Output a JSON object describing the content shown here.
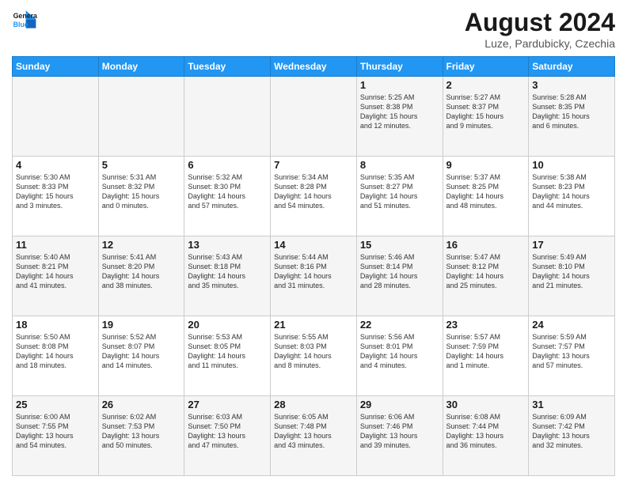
{
  "header": {
    "logo_line1": "General",
    "logo_line2": "Blue",
    "main_title": "August 2024",
    "subtitle": "Luze, Pardubicky, Czechia"
  },
  "weekdays": [
    "Sunday",
    "Monday",
    "Tuesday",
    "Wednesday",
    "Thursday",
    "Friday",
    "Saturday"
  ],
  "weeks": [
    [
      {
        "day": "",
        "info": ""
      },
      {
        "day": "",
        "info": ""
      },
      {
        "day": "",
        "info": ""
      },
      {
        "day": "",
        "info": ""
      },
      {
        "day": "1",
        "info": "Sunrise: 5:25 AM\nSunset: 8:38 PM\nDaylight: 15 hours\nand 12 minutes."
      },
      {
        "day": "2",
        "info": "Sunrise: 5:27 AM\nSunset: 8:37 PM\nDaylight: 15 hours\nand 9 minutes."
      },
      {
        "day": "3",
        "info": "Sunrise: 5:28 AM\nSunset: 8:35 PM\nDaylight: 15 hours\nand 6 minutes."
      }
    ],
    [
      {
        "day": "4",
        "info": "Sunrise: 5:30 AM\nSunset: 8:33 PM\nDaylight: 15 hours\nand 3 minutes."
      },
      {
        "day": "5",
        "info": "Sunrise: 5:31 AM\nSunset: 8:32 PM\nDaylight: 15 hours\nand 0 minutes."
      },
      {
        "day": "6",
        "info": "Sunrise: 5:32 AM\nSunset: 8:30 PM\nDaylight: 14 hours\nand 57 minutes."
      },
      {
        "day": "7",
        "info": "Sunrise: 5:34 AM\nSunset: 8:28 PM\nDaylight: 14 hours\nand 54 minutes."
      },
      {
        "day": "8",
        "info": "Sunrise: 5:35 AM\nSunset: 8:27 PM\nDaylight: 14 hours\nand 51 minutes."
      },
      {
        "day": "9",
        "info": "Sunrise: 5:37 AM\nSunset: 8:25 PM\nDaylight: 14 hours\nand 48 minutes."
      },
      {
        "day": "10",
        "info": "Sunrise: 5:38 AM\nSunset: 8:23 PM\nDaylight: 14 hours\nand 44 minutes."
      }
    ],
    [
      {
        "day": "11",
        "info": "Sunrise: 5:40 AM\nSunset: 8:21 PM\nDaylight: 14 hours\nand 41 minutes."
      },
      {
        "day": "12",
        "info": "Sunrise: 5:41 AM\nSunset: 8:20 PM\nDaylight: 14 hours\nand 38 minutes."
      },
      {
        "day": "13",
        "info": "Sunrise: 5:43 AM\nSunset: 8:18 PM\nDaylight: 14 hours\nand 35 minutes."
      },
      {
        "day": "14",
        "info": "Sunrise: 5:44 AM\nSunset: 8:16 PM\nDaylight: 14 hours\nand 31 minutes."
      },
      {
        "day": "15",
        "info": "Sunrise: 5:46 AM\nSunset: 8:14 PM\nDaylight: 14 hours\nand 28 minutes."
      },
      {
        "day": "16",
        "info": "Sunrise: 5:47 AM\nSunset: 8:12 PM\nDaylight: 14 hours\nand 25 minutes."
      },
      {
        "day": "17",
        "info": "Sunrise: 5:49 AM\nSunset: 8:10 PM\nDaylight: 14 hours\nand 21 minutes."
      }
    ],
    [
      {
        "day": "18",
        "info": "Sunrise: 5:50 AM\nSunset: 8:08 PM\nDaylight: 14 hours\nand 18 minutes."
      },
      {
        "day": "19",
        "info": "Sunrise: 5:52 AM\nSunset: 8:07 PM\nDaylight: 14 hours\nand 14 minutes."
      },
      {
        "day": "20",
        "info": "Sunrise: 5:53 AM\nSunset: 8:05 PM\nDaylight: 14 hours\nand 11 minutes."
      },
      {
        "day": "21",
        "info": "Sunrise: 5:55 AM\nSunset: 8:03 PM\nDaylight: 14 hours\nand 8 minutes."
      },
      {
        "day": "22",
        "info": "Sunrise: 5:56 AM\nSunset: 8:01 PM\nDaylight: 14 hours\nand 4 minutes."
      },
      {
        "day": "23",
        "info": "Sunrise: 5:57 AM\nSunset: 7:59 PM\nDaylight: 14 hours\nand 1 minute."
      },
      {
        "day": "24",
        "info": "Sunrise: 5:59 AM\nSunset: 7:57 PM\nDaylight: 13 hours\nand 57 minutes."
      }
    ],
    [
      {
        "day": "25",
        "info": "Sunrise: 6:00 AM\nSunset: 7:55 PM\nDaylight: 13 hours\nand 54 minutes."
      },
      {
        "day": "26",
        "info": "Sunrise: 6:02 AM\nSunset: 7:53 PM\nDaylight: 13 hours\nand 50 minutes."
      },
      {
        "day": "27",
        "info": "Sunrise: 6:03 AM\nSunset: 7:50 PM\nDaylight: 13 hours\nand 47 minutes."
      },
      {
        "day": "28",
        "info": "Sunrise: 6:05 AM\nSunset: 7:48 PM\nDaylight: 13 hours\nand 43 minutes."
      },
      {
        "day": "29",
        "info": "Sunrise: 6:06 AM\nSunset: 7:46 PM\nDaylight: 13 hours\nand 39 minutes."
      },
      {
        "day": "30",
        "info": "Sunrise: 6:08 AM\nSunset: 7:44 PM\nDaylight: 13 hours\nand 36 minutes."
      },
      {
        "day": "31",
        "info": "Sunrise: 6:09 AM\nSunset: 7:42 PM\nDaylight: 13 hours\nand 32 minutes."
      }
    ]
  ]
}
